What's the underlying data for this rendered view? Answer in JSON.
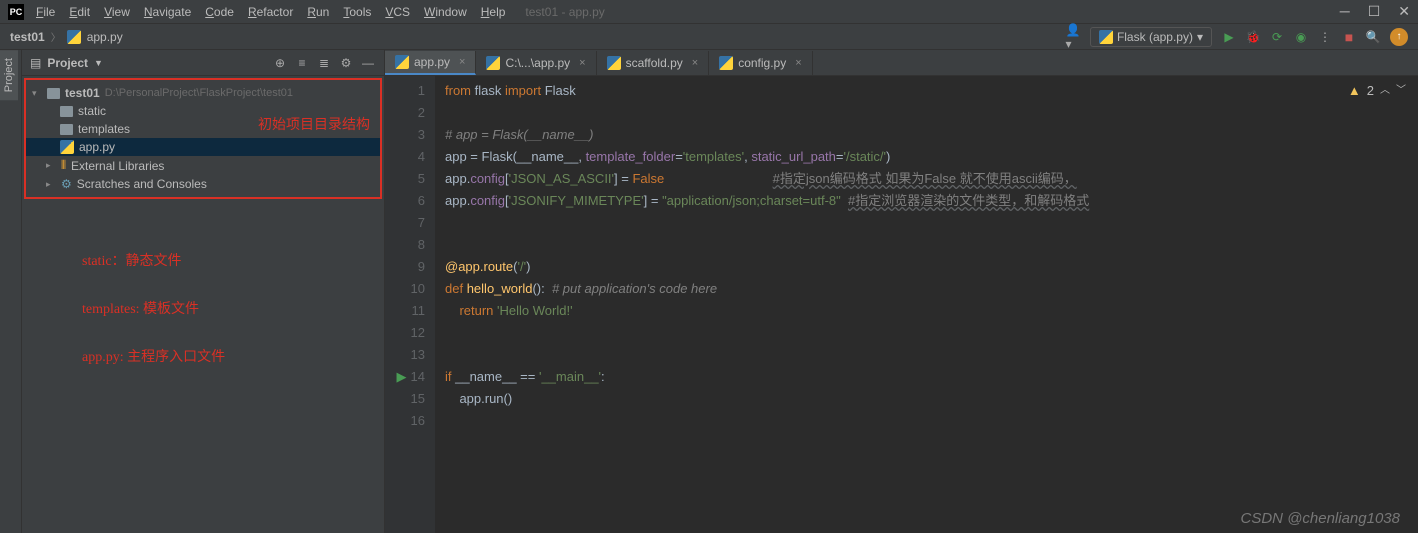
{
  "window": {
    "title": "test01 - app.py"
  },
  "menu": [
    "File",
    "Edit",
    "View",
    "Navigate",
    "Code",
    "Refactor",
    "Run",
    "Tools",
    "VCS",
    "Window",
    "Help"
  ],
  "breadcrumb": {
    "root": "test01",
    "file": "app.py"
  },
  "run_config": "Flask (app.py)",
  "project": {
    "panel_title": "Project",
    "root": "test01",
    "root_path": "D:\\PersonalProject\\FlaskProject\\test01",
    "children": [
      {
        "name": "static",
        "type": "folder"
      },
      {
        "name": "templates",
        "type": "folder"
      },
      {
        "name": "app.py",
        "type": "pyfile",
        "selected": true
      }
    ],
    "external": "External Libraries",
    "scratches": "Scratches and Consoles"
  },
  "annotations": {
    "tree_header": "初始项目目录结构",
    "static_note": "static：静态文件",
    "templates_note": "templates: 模板文件",
    "apppy_note": "app.py: 主程序入口文件"
  },
  "tabs": [
    {
      "label": "app.py",
      "active": true
    },
    {
      "label": "C:\\...\\app.py"
    },
    {
      "label": "scaffold.py"
    },
    {
      "label": "config.py"
    }
  ],
  "warnings_count": "2",
  "code_lines": [
    {
      "n": 1,
      "html": "<span class='kw'>from</span> flask <span class='kw'>import</span> Flask"
    },
    {
      "n": 2,
      "html": ""
    },
    {
      "n": 3,
      "html": "<span class='com'># app = Flask(__name__)</span>"
    },
    {
      "n": 4,
      "html": "app = Flask(__name__, <span class='pself'>template_folder</span>=<span class='str'>'templates'</span>, <span class='pself'>static_url_path</span>=<span class='str'>'/static/'</span>)"
    },
    {
      "n": 5,
      "html": "app.<span class='pself'>config</span>[<span class='str'>'JSON_AS_ASCII'</span>] = <span class='bool'>False</span>                              <span class='comwavy'>#指定json编码格式 如果为False 就不使用ascii编码，</span>"
    },
    {
      "n": 6,
      "html": "app.<span class='pself'>config</span>[<span class='str'>'JSONIFY_MIMETYPE'</span>] = <span class='str'>\"application/json;charset=utf-8\"</span>  <span class='comwavy'>#指定浏览器渲染的文件类型，和解码格式</span>"
    },
    {
      "n": 7,
      "html": ""
    },
    {
      "n": 8,
      "html": ""
    },
    {
      "n": 9,
      "html": "<span class='fn'>@app.route</span>(<span class='str'>'/'</span>)"
    },
    {
      "n": 10,
      "html": "<span class='kw'>def</span> <span class='fn'>hello_world</span>():  <span class='com'># put application's code here</span>"
    },
    {
      "n": 11,
      "html": "    <span class='kw'>return</span> <span class='str'>'Hello World!'</span>"
    },
    {
      "n": 12,
      "html": ""
    },
    {
      "n": 13,
      "html": ""
    },
    {
      "n": 14,
      "html": "<span class='kw'>if</span> __name__ == <span class='str'>'__main__'</span>:",
      "run": true
    },
    {
      "n": 15,
      "html": "    app.run()"
    },
    {
      "n": 16,
      "html": ""
    }
  ],
  "watermark": "CSDN @chenliang1038"
}
